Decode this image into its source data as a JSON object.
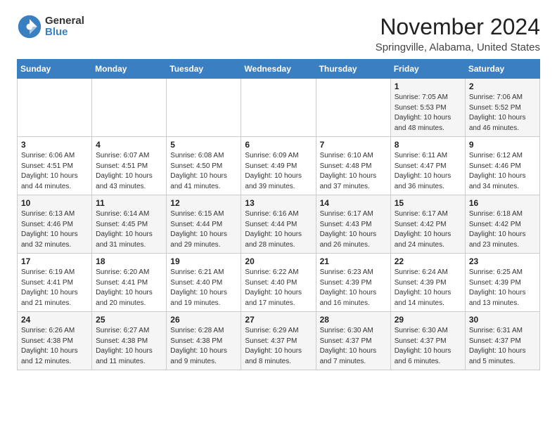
{
  "logo": {
    "text1": "General",
    "text2": "Blue"
  },
  "title": "November 2024",
  "location": "Springville, Alabama, United States",
  "weekdays": [
    "Sunday",
    "Monday",
    "Tuesday",
    "Wednesday",
    "Thursday",
    "Friday",
    "Saturday"
  ],
  "weeks": [
    [
      {
        "day": "",
        "info": ""
      },
      {
        "day": "",
        "info": ""
      },
      {
        "day": "",
        "info": ""
      },
      {
        "day": "",
        "info": ""
      },
      {
        "day": "",
        "info": ""
      },
      {
        "day": "1",
        "info": "Sunrise: 7:05 AM\nSunset: 5:53 PM\nDaylight: 10 hours and 48 minutes."
      },
      {
        "day": "2",
        "info": "Sunrise: 7:06 AM\nSunset: 5:52 PM\nDaylight: 10 hours and 46 minutes."
      }
    ],
    [
      {
        "day": "3",
        "info": "Sunrise: 6:06 AM\nSunset: 4:51 PM\nDaylight: 10 hours and 44 minutes."
      },
      {
        "day": "4",
        "info": "Sunrise: 6:07 AM\nSunset: 4:51 PM\nDaylight: 10 hours and 43 minutes."
      },
      {
        "day": "5",
        "info": "Sunrise: 6:08 AM\nSunset: 4:50 PM\nDaylight: 10 hours and 41 minutes."
      },
      {
        "day": "6",
        "info": "Sunrise: 6:09 AM\nSunset: 4:49 PM\nDaylight: 10 hours and 39 minutes."
      },
      {
        "day": "7",
        "info": "Sunrise: 6:10 AM\nSunset: 4:48 PM\nDaylight: 10 hours and 37 minutes."
      },
      {
        "day": "8",
        "info": "Sunrise: 6:11 AM\nSunset: 4:47 PM\nDaylight: 10 hours and 36 minutes."
      },
      {
        "day": "9",
        "info": "Sunrise: 6:12 AM\nSunset: 4:46 PM\nDaylight: 10 hours and 34 minutes."
      }
    ],
    [
      {
        "day": "10",
        "info": "Sunrise: 6:13 AM\nSunset: 4:46 PM\nDaylight: 10 hours and 32 minutes."
      },
      {
        "day": "11",
        "info": "Sunrise: 6:14 AM\nSunset: 4:45 PM\nDaylight: 10 hours and 31 minutes."
      },
      {
        "day": "12",
        "info": "Sunrise: 6:15 AM\nSunset: 4:44 PM\nDaylight: 10 hours and 29 minutes."
      },
      {
        "day": "13",
        "info": "Sunrise: 6:16 AM\nSunset: 4:44 PM\nDaylight: 10 hours and 28 minutes."
      },
      {
        "day": "14",
        "info": "Sunrise: 6:17 AM\nSunset: 4:43 PM\nDaylight: 10 hours and 26 minutes."
      },
      {
        "day": "15",
        "info": "Sunrise: 6:17 AM\nSunset: 4:42 PM\nDaylight: 10 hours and 24 minutes."
      },
      {
        "day": "16",
        "info": "Sunrise: 6:18 AM\nSunset: 4:42 PM\nDaylight: 10 hours and 23 minutes."
      }
    ],
    [
      {
        "day": "17",
        "info": "Sunrise: 6:19 AM\nSunset: 4:41 PM\nDaylight: 10 hours and 21 minutes."
      },
      {
        "day": "18",
        "info": "Sunrise: 6:20 AM\nSunset: 4:41 PM\nDaylight: 10 hours and 20 minutes."
      },
      {
        "day": "19",
        "info": "Sunrise: 6:21 AM\nSunset: 4:40 PM\nDaylight: 10 hours and 19 minutes."
      },
      {
        "day": "20",
        "info": "Sunrise: 6:22 AM\nSunset: 4:40 PM\nDaylight: 10 hours and 17 minutes."
      },
      {
        "day": "21",
        "info": "Sunrise: 6:23 AM\nSunset: 4:39 PM\nDaylight: 10 hours and 16 minutes."
      },
      {
        "day": "22",
        "info": "Sunrise: 6:24 AM\nSunset: 4:39 PM\nDaylight: 10 hours and 14 minutes."
      },
      {
        "day": "23",
        "info": "Sunrise: 6:25 AM\nSunset: 4:39 PM\nDaylight: 10 hours and 13 minutes."
      }
    ],
    [
      {
        "day": "24",
        "info": "Sunrise: 6:26 AM\nSunset: 4:38 PM\nDaylight: 10 hours and 12 minutes."
      },
      {
        "day": "25",
        "info": "Sunrise: 6:27 AM\nSunset: 4:38 PM\nDaylight: 10 hours and 11 minutes."
      },
      {
        "day": "26",
        "info": "Sunrise: 6:28 AM\nSunset: 4:38 PM\nDaylight: 10 hours and 9 minutes."
      },
      {
        "day": "27",
        "info": "Sunrise: 6:29 AM\nSunset: 4:37 PM\nDaylight: 10 hours and 8 minutes."
      },
      {
        "day": "28",
        "info": "Sunrise: 6:30 AM\nSunset: 4:37 PM\nDaylight: 10 hours and 7 minutes."
      },
      {
        "day": "29",
        "info": "Sunrise: 6:30 AM\nSunset: 4:37 PM\nDaylight: 10 hours and 6 minutes."
      },
      {
        "day": "30",
        "info": "Sunrise: 6:31 AM\nSunset: 4:37 PM\nDaylight: 10 hours and 5 minutes."
      }
    ]
  ]
}
